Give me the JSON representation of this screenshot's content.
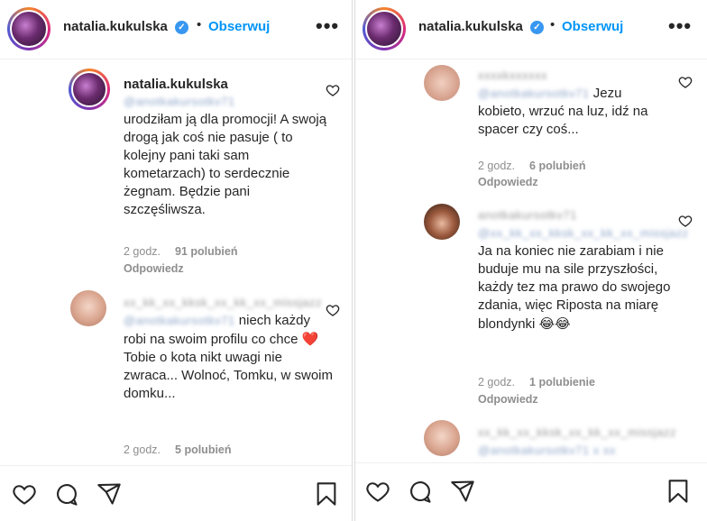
{
  "left": {
    "header": {
      "username": "natalia.kukulska",
      "separator": "•",
      "follow_label": "Obserwuj",
      "more_label": "•••"
    },
    "comments": [
      {
        "username": "natalia.kukulska",
        "mention": "@anotkakursotkv71",
        "text": "urodziłam ją dla promocji! A swoją drogą jak coś nie pasuje ( to kolejny pani taki sam kometarzach) to serdecznie żegnam. Będzie pani szczęśliwsza.",
        "time": "2 godz.",
        "likes": "91 polubień",
        "reply": "Odpowiedz"
      },
      {
        "blurred_user": "xx_kk_xx_kksk_xx_kk_xx_missjazz",
        "mention": "@anotkakursotkv71",
        "text_a": "niech każdy robi na swoim profilu co chce",
        "emoji": "❤️",
        "text_b": "Tobie o kota nikt uwagi nie zwraca... Wolnoć, Tomku, w swoim domku...",
        "time": "2 godz.",
        "likes": "5 polubień"
      }
    ]
  },
  "right": {
    "header": {
      "username": "natalia.kukulska",
      "separator": "•",
      "follow_label": "Obserwuj",
      "more_label": "•••"
    },
    "comments": [
      {
        "blurred_user": "xxxxkxxxxxx",
        "mention": "@anotkakursotkv71",
        "text": "Jezu kobieto, wrzuć na luz, idź na spacer czy coś...",
        "time": "2 godz.",
        "likes": "6 polubień",
        "reply": "Odpowiedz"
      },
      {
        "blurred_user": "anotkakursotkv71",
        "mention": "@xx_kk_xx_kksk_xx_kk_xx_missjazz",
        "text": "Ja na koniec nie zarabiam i nie buduje mu na sile przyszłości, każdy tez ma prawo do swojego zdania, więc Riposta na miarę blondynki",
        "emoji": "😂😂",
        "time": "2 godz.",
        "likes": "1 polubienie",
        "reply": "Odpowiedz"
      },
      {
        "blurred_user": "xx_kk_xx_kksk_xx_kk_xx_missjazz",
        "mention": "@anotkakursotkv71 x xx"
      }
    ]
  }
}
